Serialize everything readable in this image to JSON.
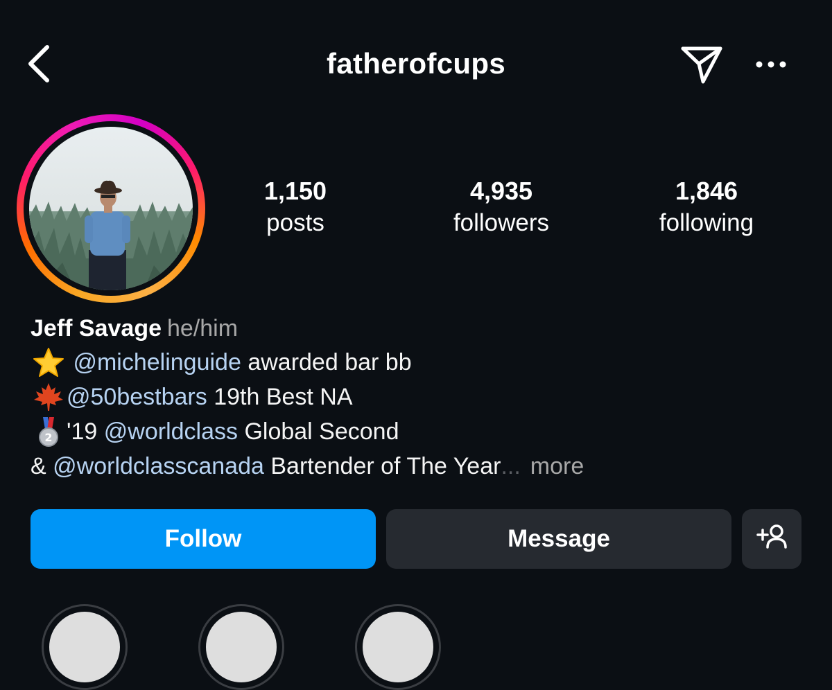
{
  "header": {
    "username": "fatherofcups",
    "back_icon": "chevron-left-icon",
    "send_icon": "paper-plane-icon",
    "more_icon": "ellipsis-icon"
  },
  "stats": {
    "posts": {
      "value": "1,150",
      "label": "posts"
    },
    "followers": {
      "value": "4,935",
      "label": "followers"
    },
    "following": {
      "value": "1,846",
      "label": "following"
    }
  },
  "profile": {
    "name": "Jeff Savage",
    "pronouns": "he/him"
  },
  "bio": {
    "line1": {
      "emoji": "star-emoji",
      "mention": "@michelinguide",
      "text": "awarded bar bb"
    },
    "line2": {
      "emoji": "maple-leaf-emoji",
      "mention": "@50bestbars",
      "text": "19th Best NA"
    },
    "line3": {
      "emoji": "second-place-medal-emoji",
      "prefix": "'19",
      "mention": "@worldclass",
      "text": "Global Second"
    },
    "line4": {
      "prefix": "&",
      "mention": "@worldclasscanada",
      "text": "Bartender of The Year",
      "ellipsis": "...",
      "more": "more"
    }
  },
  "actions": {
    "follow": "Follow",
    "message": "Message",
    "suggest_icon": "add-person-icon"
  },
  "colors": {
    "background": "#0b0f14",
    "follow_button": "#0095f6",
    "secondary_button": "#262a30",
    "mention": "#b7d3f2",
    "muted_text": "#a8a8a8"
  }
}
